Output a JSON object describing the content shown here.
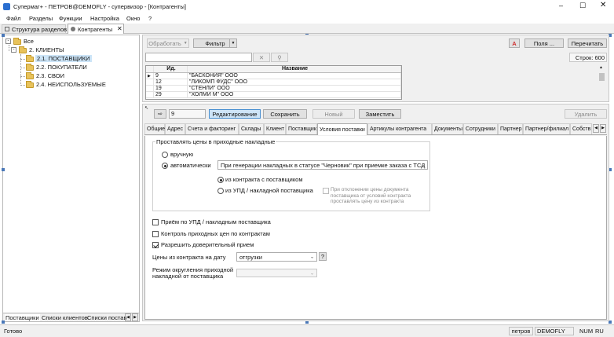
{
  "window": {
    "title": "Супермаг+ - ПЕТРОВ@DEMOFLY - супервизор - [Контрагенты]"
  },
  "menu": [
    "Файл",
    "Разделы",
    "Функции",
    "Настройка",
    "Окно",
    "?"
  ],
  "doc_tabs": [
    {
      "label": "Структура разделов"
    },
    {
      "label": "Контрагенты"
    }
  ],
  "tree": {
    "root": "Все",
    "clients": "2. КЛИЕНТЫ",
    "children": [
      "2.1. ПОСТАВЩИКИ",
      "2.2. ПОКУПАТЕЛИ",
      "2.3. СВОИ",
      "2.4. НЕИСПОЛЬЗУЕМЫЕ"
    ]
  },
  "left_bottom_tabs": [
    "Поставщики",
    "Списки клиентов",
    "Списки постав"
  ],
  "toolbar": {
    "process": "Обработать",
    "filter": "Фильтр",
    "fields": "Поля ...",
    "reread": "Перечитать",
    "rows": "Строк: 600"
  },
  "grid": {
    "headers": [
      "Ид.",
      "Название"
    ],
    "rows": [
      {
        "id": "9",
        "name": "\"БАСКОНИЯ\" ООО"
      },
      {
        "id": "12",
        "name": "\"ЛИКОМП ФУДС\" ООО"
      },
      {
        "id": "19",
        "name": "\"СТЕНЛИ\" ООО"
      },
      {
        "id": "29",
        "name": "\"ХОЛМИ М\" ООО"
      }
    ]
  },
  "detail": {
    "id_value": "9",
    "edit": "Редактирование",
    "save": "Сохранить",
    "new": "Новый",
    "replace": "Заместить",
    "delete": "Удалить"
  },
  "detail_tabs": [
    "Общие",
    "Адрес",
    "Счета и факторинг",
    "Склады",
    "Клиент",
    "Поставщик",
    "Условия поставки",
    "Артикулы контрагента",
    "Документы",
    "Сотрудники",
    "Партнер",
    "Партнер/филиал",
    "Собств"
  ],
  "form": {
    "group_title": "Проставлять цены в приходные накладные",
    "manual": "вручную",
    "auto": "автоматически",
    "auto_combo": "При генерации накладных в статусе \"Черновик\" при приемке заказа с ТСД",
    "from_contract": "из контракта с поставщиком",
    "from_upd": "из УПД / накладной поставщика",
    "deviation_note": "При отклонении цены документа поставщика от условий контракта проставлять цену из контракта",
    "chk_upd": "Приём по УПД / накладным поставщика",
    "chk_control": "Контроль приходных цен по контрактам",
    "chk_trust": "Разрешить доверительный прием",
    "price_date_label": "Цены из контракта на дату",
    "price_date_value": "отгрузки",
    "rounding_label": "Режим округления приходной накладной от поставщика",
    "rounding_value": ""
  },
  "status": {
    "ready": "Готово",
    "user": "петров",
    "db": "DEMOFLY",
    "num": "NUM",
    "lang": "RU"
  }
}
